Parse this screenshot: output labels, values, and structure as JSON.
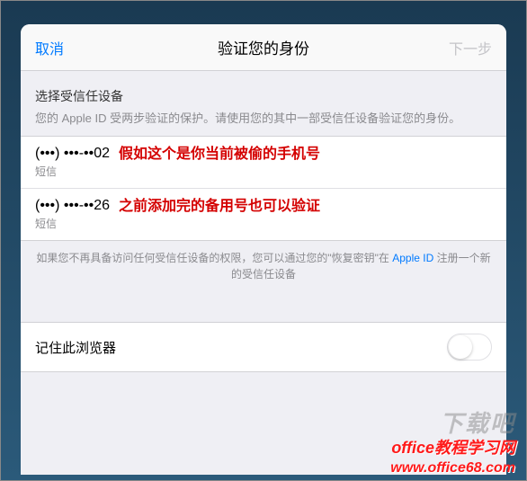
{
  "header": {
    "cancel": "取消",
    "title": "验证您的身份",
    "next": "下一步"
  },
  "info": {
    "subtitle": "选择受信任设备",
    "description": "您的 Apple ID 受两步验证的保护。请使用您的其中一部受信任设备验证您的身份。"
  },
  "devices": [
    {
      "number": "(•••) •••-••02",
      "type": "短信",
      "annotation": "假如这个是你当前被偷的手机号"
    },
    {
      "number": "(•••) •••-••26",
      "type": "短信",
      "annotation": "之前添加完的备用号也可以验证"
    }
  ],
  "footer": {
    "text_before": "如果您不再具备访问任何受信任设备的权限，您可以通过您的\"恢复密钥\"在 ",
    "link": "Apple ID",
    "text_after": " 注册一个新的受信任设备"
  },
  "remember": {
    "label": "记住此浏览器"
  },
  "watermarks": {
    "bg": "下载吧",
    "line1": "office教程学习网",
    "line2": "www.office68.com"
  }
}
